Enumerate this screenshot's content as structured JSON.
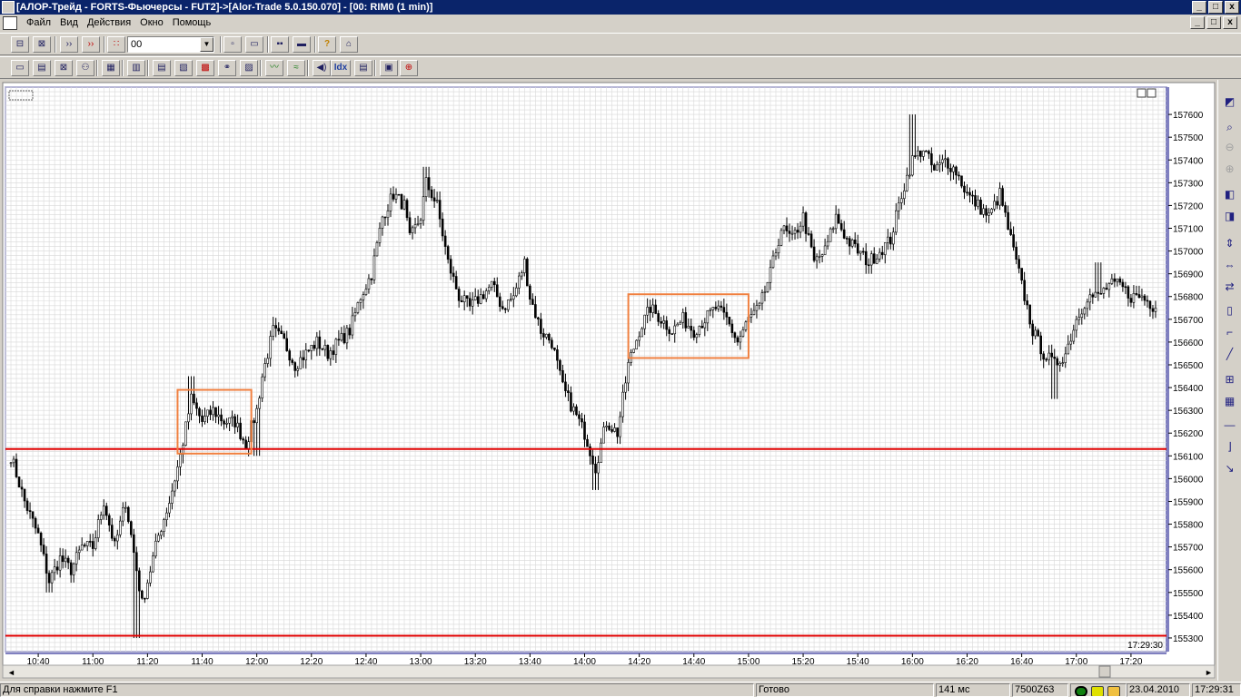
{
  "window": {
    "title": "[АЛОР-Трейд - FORTS-Фьючерсы - FUT2]->[Alor-Trade 5.0.150.070] - [00: RIM0 (1 min)]",
    "minimize": "_",
    "maximize": "□",
    "close": "x"
  },
  "menu": {
    "items": [
      "Файл",
      "Вид",
      "Действия",
      "Окно",
      "Помощь"
    ]
  },
  "toolbar": {
    "account_combo_value": "00",
    "idx_label": "Idx"
  },
  "chart_data": {
    "type": "candlestick",
    "instrument": "RIM0",
    "timeframe": "1 min",
    "cursor_time": "17:29:30",
    "ylim": [
      155240,
      157720
    ],
    "y_ticks": [
      155300,
      155400,
      155500,
      155600,
      155700,
      155800,
      155900,
      156000,
      156100,
      156200,
      156300,
      156400,
      156500,
      156600,
      156700,
      156800,
      156900,
      157000,
      157100,
      157200,
      157300,
      157400,
      157500,
      157600
    ],
    "x_ticks": [
      "10:40",
      "11:00",
      "11:20",
      "11:40",
      "12:00",
      "12:20",
      "12:40",
      "13:00",
      "13:20",
      "13:40",
      "14:00",
      "14:20",
      "14:40",
      "15:00",
      "15:20",
      "15:40",
      "16:00",
      "16:20",
      "16:40",
      "17:00",
      "17:20"
    ],
    "close_path": [
      [
        "10:30",
        156100
      ],
      [
        "10:35",
        155900
      ],
      [
        "10:40",
        155750
      ],
      [
        "10:44",
        155550
      ],
      [
        "10:48",
        155650
      ],
      [
        "10:52",
        155600
      ],
      [
        "10:56",
        155700
      ],
      [
        "11:00",
        155700
      ],
      [
        "11:04",
        155900
      ],
      [
        "11:08",
        155700
      ],
      [
        "11:12",
        155900
      ],
      [
        "11:16",
        155600
      ],
      [
        "11:18",
        155450
      ],
      [
        "11:20",
        155550
      ],
      [
        "11:24",
        155750
      ],
      [
        "11:28",
        155900
      ],
      [
        "11:32",
        156100
      ],
      [
        "11:36",
        156350
      ],
      [
        "11:40",
        156250
      ],
      [
        "11:44",
        156300
      ],
      [
        "11:48",
        156250
      ],
      [
        "11:52",
        156250
      ],
      [
        "11:56",
        156150
      ],
      [
        "12:00",
        156300
      ],
      [
        "12:02",
        156450
      ],
      [
        "12:06",
        156650
      ],
      [
        "12:10",
        156600
      ],
      [
        "12:14",
        156500
      ],
      [
        "12:18",
        156550
      ],
      [
        "12:22",
        156600
      ],
      [
        "12:26",
        156550
      ],
      [
        "12:30",
        156600
      ],
      [
        "12:34",
        156650
      ],
      [
        "12:38",
        156800
      ],
      [
        "12:42",
        156900
      ],
      [
        "12:46",
        157150
      ],
      [
        "12:50",
        157250
      ],
      [
        "12:54",
        157200
      ],
      [
        "12:56",
        157050
      ],
      [
        "13:00",
        157150
      ],
      [
        "13:02",
        157300
      ],
      [
        "13:06",
        157200
      ],
      [
        "13:10",
        156950
      ],
      [
        "13:14",
        156800
      ],
      [
        "13:18",
        156750
      ],
      [
        "13:22",
        156800
      ],
      [
        "13:26",
        156850
      ],
      [
        "13:30",
        156750
      ],
      [
        "13:34",
        156800
      ],
      [
        "13:38",
        156950
      ],
      [
        "13:40",
        156800
      ],
      [
        "13:44",
        156650
      ],
      [
        "13:48",
        156600
      ],
      [
        "13:52",
        156400
      ],
      [
        "13:56",
        156300
      ],
      [
        "14:00",
        156200
      ],
      [
        "14:04",
        156050
      ],
      [
        "14:08",
        156250
      ],
      [
        "14:12",
        156200
      ],
      [
        "14:16",
        156500
      ],
      [
        "14:20",
        156650
      ],
      [
        "14:24",
        156750
      ],
      [
        "14:28",
        156700
      ],
      [
        "14:32",
        156650
      ],
      [
        "14:36",
        156700
      ],
      [
        "14:40",
        156650
      ],
      [
        "14:44",
        156700
      ],
      [
        "14:48",
        156750
      ],
      [
        "14:52",
        156700
      ],
      [
        "14:56",
        156600
      ],
      [
        "15:00",
        156700
      ],
      [
        "15:04",
        156750
      ],
      [
        "15:08",
        156900
      ],
      [
        "15:12",
        157100
      ],
      [
        "15:16",
        157050
      ],
      [
        "15:20",
        157150
      ],
      [
        "15:24",
        156950
      ],
      [
        "15:28",
        157000
      ],
      [
        "15:32",
        157150
      ],
      [
        "15:36",
        157050
      ],
      [
        "15:40",
        157000
      ],
      [
        "15:44",
        156950
      ],
      [
        "15:48",
        157000
      ],
      [
        "15:52",
        157050
      ],
      [
        "15:56",
        157250
      ],
      [
        "16:00",
        157400
      ],
      [
        "16:04",
        157450
      ],
      [
        "16:08",
        157350
      ],
      [
        "16:12",
        157400
      ],
      [
        "16:16",
        157350
      ],
      [
        "16:20",
        157250
      ],
      [
        "16:24",
        157200
      ],
      [
        "16:28",
        157150
      ],
      [
        "16:32",
        157250
      ],
      [
        "16:36",
        157050
      ],
      [
        "16:40",
        156850
      ],
      [
        "16:44",
        156650
      ],
      [
        "16:48",
        156550
      ],
      [
        "16:52",
        156500
      ],
      [
        "16:56",
        156550
      ],
      [
        "17:00",
        156700
      ],
      [
        "17:04",
        156800
      ],
      [
        "17:08",
        156800
      ],
      [
        "17:12",
        156850
      ],
      [
        "17:16",
        156850
      ],
      [
        "17:20",
        156800
      ],
      [
        "17:24",
        156800
      ],
      [
        "17:29",
        156750
      ]
    ],
    "lows": [
      [
        "10:30",
        156050
      ],
      [
        "10:44",
        155500
      ],
      [
        "11:16",
        155300
      ],
      [
        "12:00",
        156100
      ],
      [
        "14:04",
        155950
      ],
      [
        "15:44",
        156900
      ],
      [
        "16:52",
        156350
      ]
    ],
    "highs": [
      [
        "11:36",
        156450
      ],
      [
        "13:02",
        157370
      ],
      [
        "16:00",
        157600
      ],
      [
        "17:08",
        156950
      ]
    ],
    "levels": [
      {
        "value": 156130,
        "color": "#e00000"
      },
      {
        "value": 155310,
        "color": "#e00000"
      }
    ],
    "rectangles": [
      {
        "t1": "11:31",
        "t2": "11:58",
        "v1": 156110,
        "v2": 156390,
        "color": "#f08040"
      },
      {
        "t1": "14:16",
        "t2": "15:00",
        "v1": 156530,
        "v2": 156810,
        "color": "#f08040"
      }
    ],
    "grid": true
  },
  "status": {
    "help": "Для справки нажмите F1",
    "state": "Готово",
    "latency": "141 мс",
    "account": "7500Z63",
    "date": "23.04.2010",
    "time": "17:29:31"
  },
  "colors": {
    "title_bg": "#0a246a",
    "window_bg": "#d4d0c8",
    "grid": "#d8d8d8",
    "level_line": "#e00000",
    "rect_line": "#f08040",
    "candle": "#000000"
  }
}
